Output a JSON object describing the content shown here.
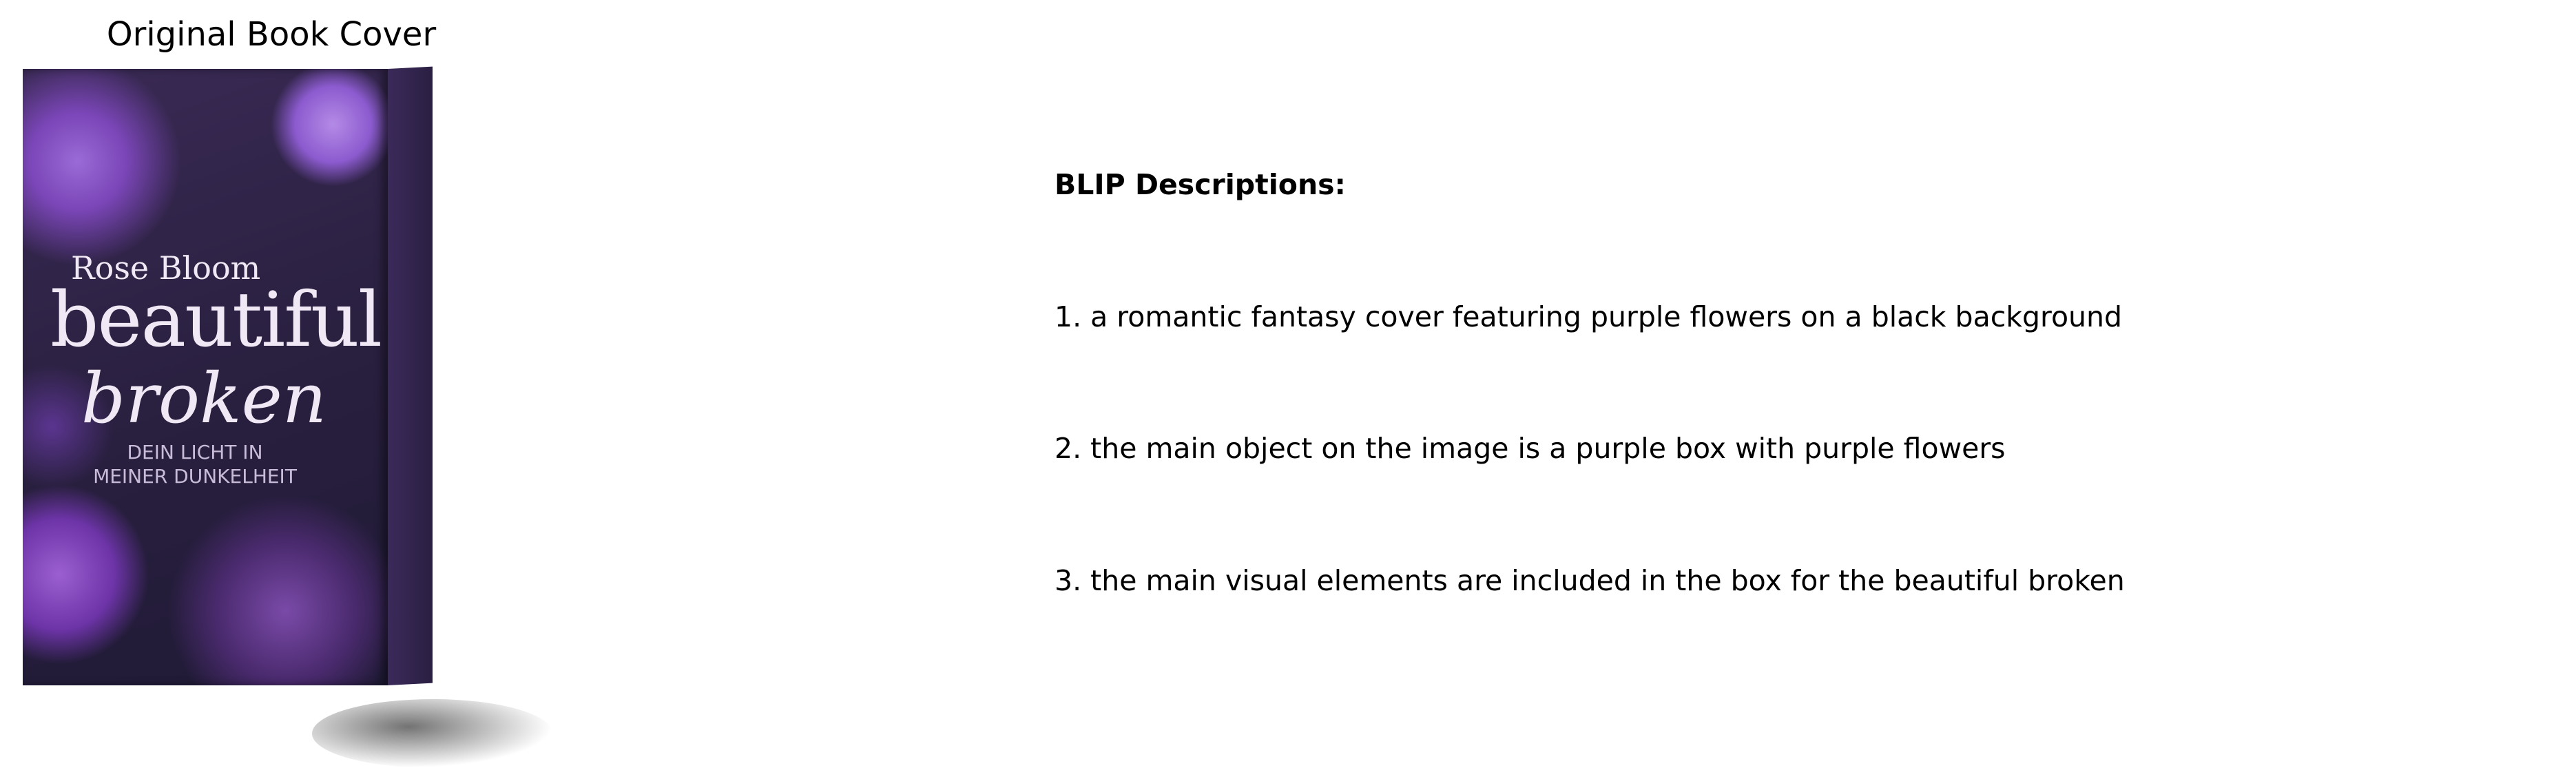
{
  "left_panel": {
    "title": "Original Book Cover",
    "cover": {
      "author": "Rose Bloom",
      "title_line1": "beautiful",
      "title_line2": "broken",
      "subtitle_line1": "DEIN LICHT IN",
      "subtitle_line2": "MEINER DUNKELHEIT"
    }
  },
  "right_panel": {
    "heading": "BLIP Descriptions:",
    "descriptions": [
      "1. a romantic fantasy cover featuring purple flowers on a black background",
      "2. the main object on the image is a purple box with purple flowers",
      "3. the main visual elements are included in the box for the beautiful broken"
    ]
  }
}
